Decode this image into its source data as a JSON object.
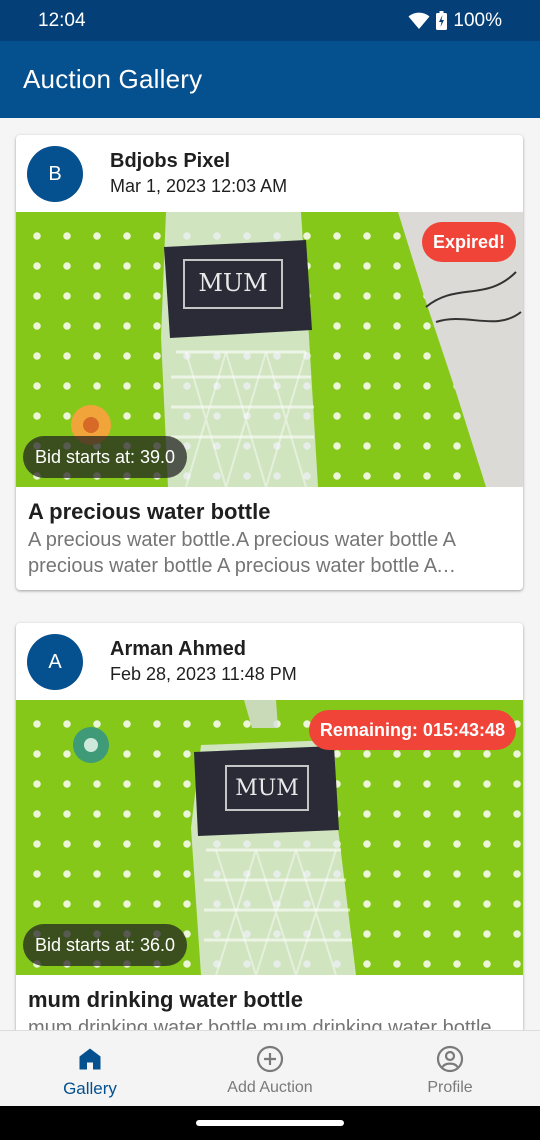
{
  "status_bar": {
    "time": "12:04",
    "battery": "100%"
  },
  "app_bar": {
    "title": "Auction Gallery"
  },
  "posts": [
    {
      "avatar_letter": "B",
      "author": "Bdjobs Pixel",
      "date": "Mar 1, 2023 12:03 AM",
      "badge": "Expired!",
      "bid": "Bid starts at: 39.0",
      "title": "A precious water bottle",
      "description": "A precious water bottle.A precious water bottle A precious water bottle A precious water bottle A precious water bottle",
      "label_text": "MUM"
    },
    {
      "avatar_letter": "A",
      "author": "Arman Ahmed",
      "date": "Feb 28, 2023 11:48 PM",
      "badge": "Remaining: 015:43:48",
      "bid": "Bid starts at: 36.0",
      "title": "mum drinking water bottle",
      "description": "mum drinking water bottle mum drinking water bottle",
      "label_text": "MUM"
    }
  ],
  "bottom_nav": {
    "items": [
      {
        "label": "Gallery",
        "icon": "home-icon",
        "active": true
      },
      {
        "label": "Add Auction",
        "icon": "add-circle-icon",
        "active": false
      },
      {
        "label": "Profile",
        "icon": "account-circle-icon",
        "active": false
      }
    ]
  },
  "colors": {
    "primary": "#05508e",
    "status_bar": "#043f77",
    "badge_red": "#f04438",
    "inactive_nav": "#7a7a7a"
  }
}
